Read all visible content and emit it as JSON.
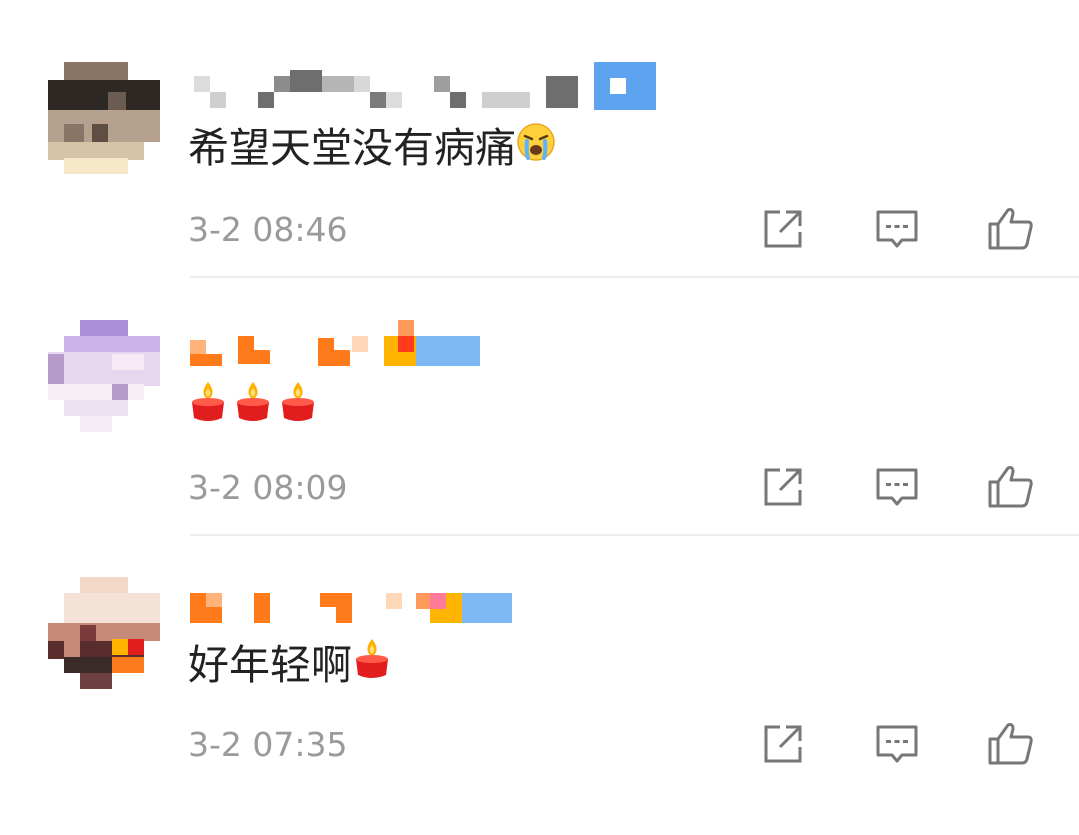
{
  "comments": [
    {
      "text": "希望天堂没有病痛",
      "emoji": "crying-face-icon",
      "time": "3-2 08:46",
      "avatar_colors": [
        "#8a7466",
        "#2e2824",
        "#b6a18f",
        "#d6c3a8",
        "#f5e7c8"
      ],
      "name_colors": [
        "#9e9e9e",
        "#6e6e6e",
        "#cfcfcf"
      ],
      "badge_color": "#5ea3f0"
    },
    {
      "text": "",
      "emoji": "candle-icon",
      "emoji_count": 3,
      "time": "3-2 08:09",
      "avatar_colors": [
        "#a98fd8",
        "#e7d6f0",
        "#c9b3e8",
        "#f5eef5",
        "#b69bc8"
      ],
      "name_colors": [
        "#ff7a1a",
        "#ffb27a",
        "#ff5a20"
      ],
      "badge_color": "#5ea3f0"
    },
    {
      "text": "好年轻啊",
      "emoji": "candle-icon",
      "time": "3-2 07:35",
      "avatar_colors": [
        "#f3d8c8",
        "#7a3b3b",
        "#c78a7a",
        "#3b2a2a",
        "#ffb400"
      ],
      "name_colors": [
        "#ff7a1a",
        "#ffb27a",
        "#ff5a20"
      ],
      "badge_color": "#5ea3f0"
    }
  ],
  "actions": {
    "share_icon": "share-icon",
    "reply_icon": "reply-icon",
    "like_icon": "thumbs-up-icon",
    "icon_color": "#777777"
  }
}
